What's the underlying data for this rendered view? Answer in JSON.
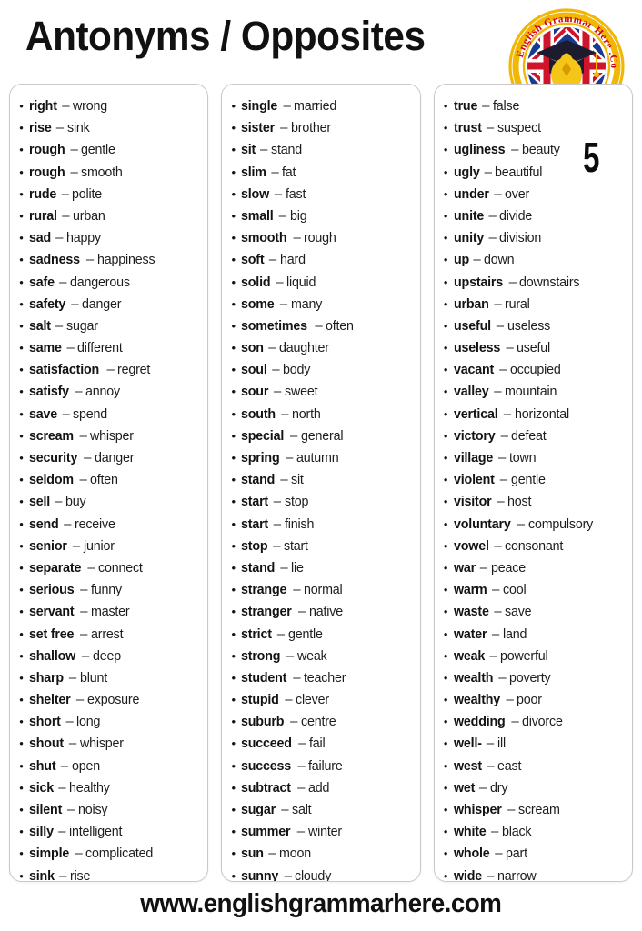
{
  "header": {
    "title": "Antonyms / Opposites"
  },
  "logo": {
    "name": "english-grammar-here-logo",
    "arc_text_left": "English",
    "arc_text_mid": "Grammar",
    "arc_text_right": "Here",
    "arc_text_end": ".Com",
    "full_text": "English Grammar Here .Com",
    "ring_color": "#f2b705",
    "text_color": "#d0021b",
    "bulb_color": "#f5c518",
    "flag_blue": "#1a3a8f",
    "flag_red": "#cf142b",
    "cap_color": "#1c1c2e"
  },
  "page_number": "5",
  "footer": {
    "url": "www.englishgrammarhere.com"
  },
  "bullet_glyph": "•",
  "dash_glyph": "–",
  "columns": [
    {
      "name": "column-1",
      "items": [
        {
          "term": "right",
          "opposite": "wrong"
        },
        {
          "term": "rise",
          "opposite": "sink"
        },
        {
          "term": "rough",
          "opposite": "gentle"
        },
        {
          "term": "rough",
          "opposite": "smooth"
        },
        {
          "term": "rude",
          "opposite": "polite"
        },
        {
          "term": "rural",
          "opposite": "urban"
        },
        {
          "term": "sad",
          "opposite": "happy"
        },
        {
          "term": "sadness",
          "opposite": "happiness"
        },
        {
          "term": "safe",
          "opposite": "dangerous"
        },
        {
          "term": "safety",
          "opposite": "danger"
        },
        {
          "term": "salt",
          "opposite": "sugar"
        },
        {
          "term": "same",
          "opposite": "different"
        },
        {
          "term": "satisfaction",
          "opposite": "regret"
        },
        {
          "term": "satisfy",
          "opposite": "annoy"
        },
        {
          "term": "save",
          "opposite": "spend"
        },
        {
          "term": "scream",
          "opposite": "whisper"
        },
        {
          "term": "security",
          "opposite": "danger"
        },
        {
          "term": "seldom",
          "opposite": "often"
        },
        {
          "term": "sell",
          "opposite": "buy"
        },
        {
          "term": "send",
          "opposite": "receive"
        },
        {
          "term": "senior",
          "opposite": "junior"
        },
        {
          "term": "separate",
          "opposite": "connect"
        },
        {
          "term": "serious",
          "opposite": "funny"
        },
        {
          "term": "servant",
          "opposite": "master"
        },
        {
          "term": "set free",
          "opposite": "arrest"
        },
        {
          "term": "shallow",
          "opposite": "deep"
        },
        {
          "term": "sharp",
          "opposite": "blunt"
        },
        {
          "term": "shelter",
          "opposite": "exposure"
        },
        {
          "term": "short",
          "opposite": "long"
        },
        {
          "term": "shout",
          "opposite": "whisper"
        },
        {
          "term": "shut",
          "opposite": "open"
        },
        {
          "term": "sick",
          "opposite": "healthy"
        },
        {
          "term": "silent",
          "opposite": "noisy"
        },
        {
          "term": "silly",
          "opposite": "intelligent"
        },
        {
          "term": "simple",
          "opposite": "complicated"
        },
        {
          "term": "sink",
          "opposite": "rise"
        }
      ]
    },
    {
      "name": "column-2",
      "items": [
        {
          "term": "single",
          "opposite": "married"
        },
        {
          "term": "sister",
          "opposite": "brother"
        },
        {
          "term": "sit",
          "opposite": "stand"
        },
        {
          "term": "slim",
          "opposite": "fat"
        },
        {
          "term": "slow",
          "opposite": "fast"
        },
        {
          "term": "small",
          "opposite": "big"
        },
        {
          "term": "smooth",
          "opposite": "rough"
        },
        {
          "term": "soft",
          "opposite": "hard"
        },
        {
          "term": "solid",
          "opposite": "liquid"
        },
        {
          "term": "some",
          "opposite": "many"
        },
        {
          "term": "sometimes",
          "opposite": "often"
        },
        {
          "term": "son",
          "opposite": "daughter"
        },
        {
          "term": "soul",
          "opposite": "body"
        },
        {
          "term": "sour",
          "opposite": "sweet"
        },
        {
          "term": "south",
          "opposite": "north"
        },
        {
          "term": "special",
          "opposite": "general"
        },
        {
          "term": "spring",
          "opposite": "autumn"
        },
        {
          "term": "stand",
          "opposite": "sit"
        },
        {
          "term": "start",
          "opposite": "stop"
        },
        {
          "term": "start",
          "opposite": "finish"
        },
        {
          "term": "stop",
          "opposite": "start"
        },
        {
          "term": "stand",
          "opposite": "lie"
        },
        {
          "term": "strange",
          "opposite": "normal"
        },
        {
          "term": "stranger",
          "opposite": "native"
        },
        {
          "term": "strict",
          "opposite": "gentle"
        },
        {
          "term": "strong",
          "opposite": "weak"
        },
        {
          "term": "student",
          "opposite": "teacher"
        },
        {
          "term": "stupid",
          "opposite": "clever"
        },
        {
          "term": "suburb",
          "opposite": "centre"
        },
        {
          "term": "succeed",
          "opposite": "fail"
        },
        {
          "term": "success",
          "opposite": "failure"
        },
        {
          "term": "subtract",
          "opposite": "add"
        },
        {
          "term": "sugar",
          "opposite": "salt"
        },
        {
          "term": "summer",
          "opposite": "winter"
        },
        {
          "term": "sun",
          "opposite": "moon"
        },
        {
          "term": "sunny",
          "opposite": "cloudy"
        }
      ]
    },
    {
      "name": "column-3",
      "items": [
        {
          "term": "true",
          "opposite": "false"
        },
        {
          "term": "trust",
          "opposite": "suspect"
        },
        {
          "term": "ugliness",
          "opposite": "beauty"
        },
        {
          "term": "ugly",
          "opposite": "beautiful"
        },
        {
          "term": "under",
          "opposite": "over"
        },
        {
          "term": "unite",
          "opposite": "divide"
        },
        {
          "term": "unity",
          "opposite": "division"
        },
        {
          "term": "up",
          "opposite": "down"
        },
        {
          "term": "upstairs",
          "opposite": "downstairs"
        },
        {
          "term": "urban",
          "opposite": "rural"
        },
        {
          "term": "useful",
          "opposite": "useless"
        },
        {
          "term": "useless",
          "opposite": "useful"
        },
        {
          "term": "vacant",
          "opposite": "occupied"
        },
        {
          "term": "valley",
          "opposite": "mountain"
        },
        {
          "term": "vertical",
          "opposite": "horizontal"
        },
        {
          "term": "victory",
          "opposite": "defeat"
        },
        {
          "term": "village",
          "opposite": "town"
        },
        {
          "term": "violent",
          "opposite": "gentle"
        },
        {
          "term": "visitor",
          "opposite": "host"
        },
        {
          "term": "voluntary",
          "opposite": "compulsory"
        },
        {
          "term": "vowel",
          "opposite": "consonant"
        },
        {
          "term": "war",
          "opposite": "peace"
        },
        {
          "term": "warm",
          "opposite": "cool"
        },
        {
          "term": "waste",
          "opposite": "save"
        },
        {
          "term": "water",
          "opposite": "land"
        },
        {
          "term": "weak",
          "opposite": "powerful"
        },
        {
          "term": "wealth",
          "opposite": "poverty"
        },
        {
          "term": "wealthy",
          "opposite": "poor"
        },
        {
          "term": "wedding",
          "opposite": "divorce"
        },
        {
          "term": "well-",
          "opposite": "ill"
        },
        {
          "term": "west",
          "opposite": "east"
        },
        {
          "term": "wet",
          "opposite": "dry"
        },
        {
          "term": "whisper",
          "opposite": "scream"
        },
        {
          "term": "white",
          "opposite": "black"
        },
        {
          "term": "whole",
          "opposite": "part"
        },
        {
          "term": "wide",
          "opposite": "narrow"
        }
      ]
    }
  ]
}
